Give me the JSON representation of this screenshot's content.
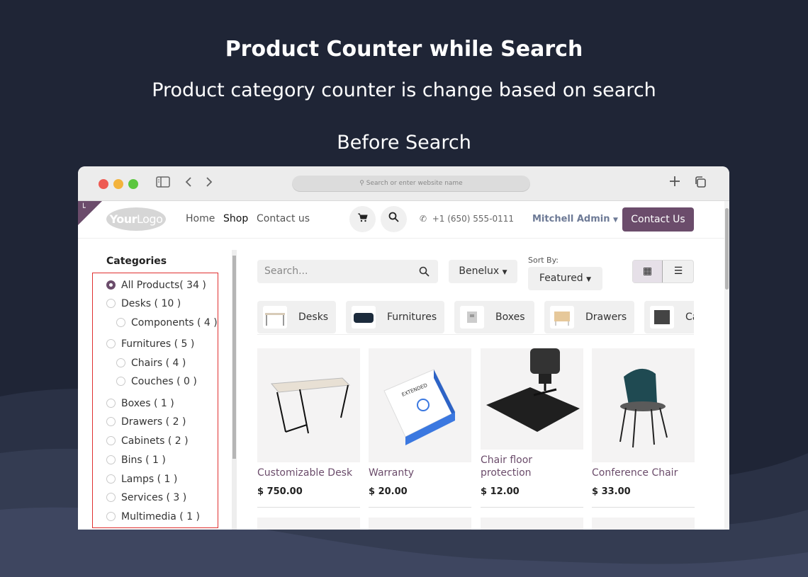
{
  "hero": {
    "title": "Product Counter while Search",
    "subtitle": "Product category counter is change based on search",
    "caption": "Before Search"
  },
  "browser": {
    "address_placeholder": "Search or enter website name",
    "new_tab_icon": "plus-icon",
    "tabs_icon": "copy-icon"
  },
  "navbar": {
    "logo_bold": "Your",
    "logo_light": "Logo",
    "links": [
      "Home",
      "Shop",
      "Contact us"
    ],
    "active_link": "Shop",
    "phone": "+1 (650) 555-0111",
    "user": "Mitchell Admin",
    "contact_button": "Contact Us",
    "accent": "#6b4c6b"
  },
  "sidebar": {
    "title": "Categories",
    "items": [
      {
        "label": "All Products( 34 )",
        "selected": true
      },
      {
        "label": "Desks ( 10 )"
      },
      {
        "label": "Components ( 4 )"
      },
      {
        "label": "Furnitures ( 5 )"
      },
      {
        "label": "Chairs ( 4 )"
      },
      {
        "label": "Couches ( 0 )"
      },
      {
        "label": "Boxes ( 1 )"
      },
      {
        "label": "Drawers ( 2 )"
      },
      {
        "label": "Cabinets ( 2 )"
      },
      {
        "label": "Bins ( 1 )"
      },
      {
        "label": "Lamps ( 1 )"
      },
      {
        "label": "Services ( 3 )"
      },
      {
        "label": "Multimedia ( 1 )"
      }
    ]
  },
  "toolbar": {
    "search_placeholder": "Search...",
    "pricelist": "Benelux",
    "sort_label": "Sort By:",
    "sort_value": "Featured"
  },
  "category_chips": [
    "Desks",
    "Furnitures",
    "Boxes",
    "Drawers",
    "Ca"
  ],
  "products": [
    {
      "name": "Customizable Desk",
      "price": "$ 750.00"
    },
    {
      "name": "Warranty",
      "price": "$ 20.00"
    },
    {
      "name": "Chair floor protection",
      "price": "$ 12.00"
    },
    {
      "name": "Conference Chair",
      "price": "$ 33.00"
    }
  ]
}
